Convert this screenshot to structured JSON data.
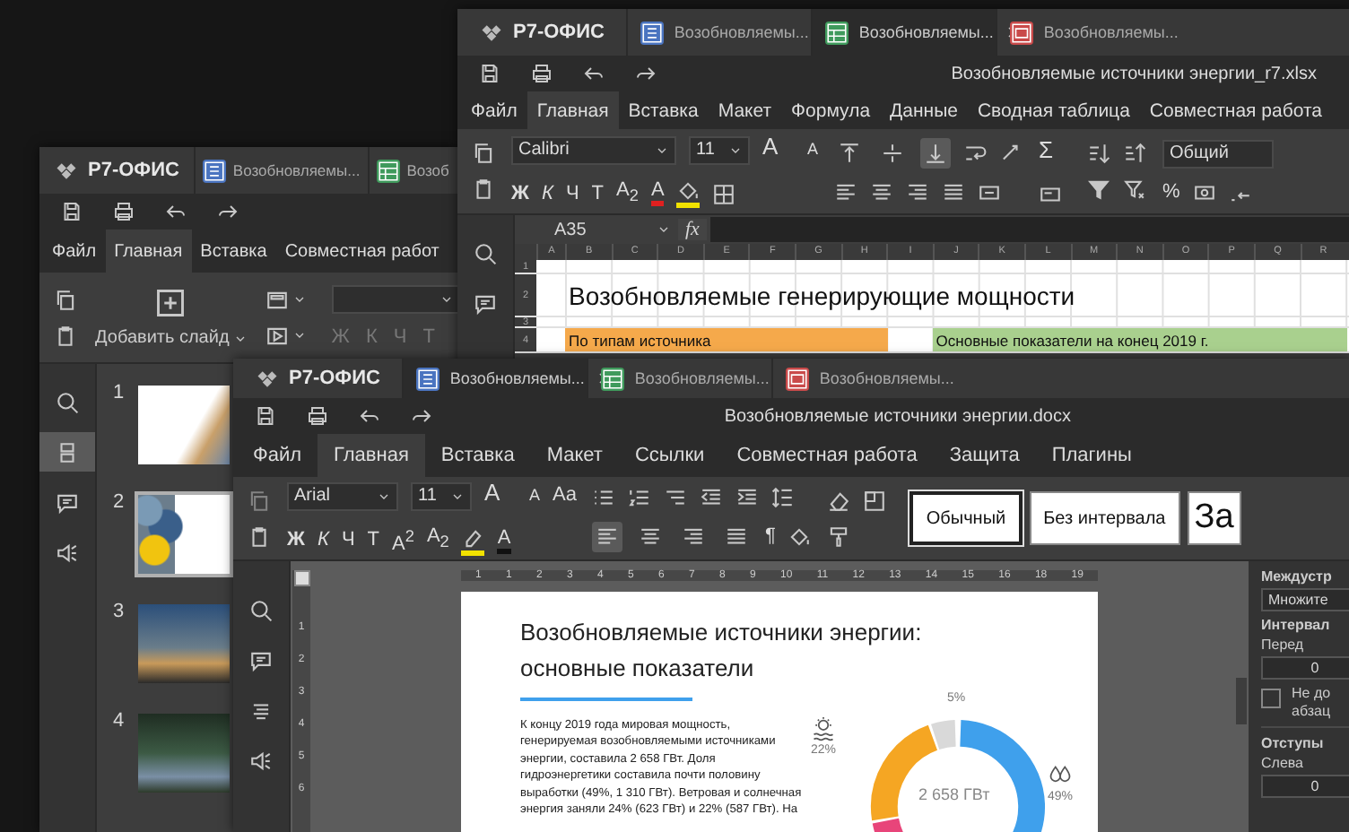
{
  "presentation_window": {
    "logo": "Р7-ОФИС",
    "tabs": [
      {
        "label": "Возобновляемы...",
        "kind": "document",
        "selected": false
      },
      {
        "label": "Возоб",
        "kind": "spreadsheet",
        "selected": false
      }
    ],
    "menu": [
      {
        "label": "Файл",
        "selected": false
      },
      {
        "label": "Главная",
        "selected": true
      },
      {
        "label": "Вставка",
        "selected": false
      },
      {
        "label": "Совместная работ",
        "selected": false
      }
    ],
    "add_slide": "Добавить слайд",
    "format_buttons": [
      {
        "label": "Ж",
        "disabled": true
      },
      {
        "label": "К",
        "disabled": true
      },
      {
        "label": "Ч",
        "disabled": true
      },
      {
        "label": "Т",
        "disabled": true
      }
    ],
    "sidebar": [
      {
        "selected": false
      },
      {
        "selected": true
      },
      {
        "selected": false
      },
      {
        "selected": false
      }
    ],
    "slides": [
      {
        "number": "1",
        "kind": "title",
        "selected": false
      },
      {
        "number": "2",
        "kind": "collage",
        "selected": true
      },
      {
        "number": "3",
        "kind": "photo",
        "selected": false
      },
      {
        "number": "4",
        "kind": "photo",
        "selected": false
      }
    ]
  },
  "spreadsheet_window": {
    "logo": "Р7-ОФИС",
    "tabs": [
      {
        "label": "Возобновляемы...",
        "kind": "document",
        "selected": false
      },
      {
        "label": "Возобновляемы...",
        "kind": "spreadsheet",
        "selected": true
      },
      {
        "label": "Возобновляемы...",
        "kind": "pdf",
        "selected": false
      }
    ],
    "filename": "Возобновляемые источники энергии_r7.xlsx",
    "menu": [
      {
        "label": "Файл",
        "selected": false
      },
      {
        "label": "Главная",
        "selected": true
      },
      {
        "label": "Вставка",
        "selected": false
      },
      {
        "label": "Макет",
        "selected": false
      },
      {
        "label": "Формула",
        "selected": false
      },
      {
        "label": "Данные",
        "selected": false
      },
      {
        "label": "Сводная таблица",
        "selected": false
      },
      {
        "label": "Совместная работа",
        "selected": false
      }
    ],
    "toolbar": {
      "font": "Calibri",
      "size": "11",
      "grow": "A",
      "shrink": "A",
      "bold": "Ж",
      "italic": "К",
      "underline": "Ч",
      "strike": "Т",
      "subscript": "A$_{2}$",
      "font_color": "A",
      "sum": "Σ",
      "number_format": "Общий",
      "percent": "%",
      "vertical_align": [
        {
          "selected": false
        },
        {
          "selected": false
        },
        {
          "selected": true
        }
      ]
    },
    "name_box": "A35",
    "fx": "fx",
    "columns": [
      "A",
      "B",
      "C",
      "D",
      "E",
      "F",
      "G",
      "H",
      "I",
      "J",
      "K",
      "L",
      "M",
      "N",
      "O",
      "P",
      "Q",
      "R"
    ],
    "rows": [
      {
        "number": "1",
        "cells": []
      },
      {
        "number": "2",
        "cells": [
          {},
          {
            "text": "Возобновляемые генерирующие мощности",
            "kind": "title"
          }
        ]
      },
      {
        "number": "3",
        "cells": []
      },
      {
        "number": "4",
        "cells": [
          {},
          {
            "text": "По типам источника",
            "kind": "header",
            "color": "#f5a94b"
          },
          {
            "color": "#f5a94b"
          },
          {
            "color": "#f5a94b"
          },
          {
            "color": "#f5a94b"
          },
          {
            "color": "#f5a94b"
          },
          {
            "color": "#f5a94b"
          },
          {
            "color": "#f5a94b"
          },
          {},
          {
            "text": "Основные показатели на конец 2019 г.",
            "kind": "header",
            "color": "#a9d08e"
          },
          {
            "color": "#a9d08e"
          },
          {
            "color": "#a9d08e"
          },
          {
            "color": "#a9d08e"
          },
          {
            "color": "#a9d08e"
          },
          {
            "color": "#a9d08e"
          },
          {
            "color": "#a9d08e"
          },
          {
            "color": "#a9d08e"
          },
          {
            "color": "#a9d08e"
          }
        ]
      }
    ]
  },
  "document_window": {
    "logo": "Р7-ОФИС",
    "tabs": [
      {
        "label": "Возобновляемы...",
        "kind": "document",
        "selected": true
      },
      {
        "label": "Возобновляемы...",
        "kind": "spreadsheet",
        "selected": false
      },
      {
        "label": "Возобновляемы...",
        "kind": "pdf",
        "selected": false
      }
    ],
    "filename": "Возобновляемые источники энергии.docx",
    "menu": [
      {
        "label": "Файл",
        "selected": false
      },
      {
        "label": "Главная",
        "selected": true
      },
      {
        "label": "Вставка",
        "selected": false
      },
      {
        "label": "Макет",
        "selected": false
      },
      {
        "label": "Ссылки",
        "selected": false
      },
      {
        "label": "Совместная работа",
        "selected": false
      },
      {
        "label": "Защита",
        "selected": false
      },
      {
        "label": "Плагины",
        "selected": false
      }
    ],
    "toolbar": {
      "font": "Arial",
      "size": "11",
      "grow": "A",
      "shrink": "A",
      "case": "Aa",
      "bold": "Ж",
      "italic": "К",
      "underline": "Ч",
      "strike": "Т",
      "superscript": "A$^{2}$",
      "subscript": "A$_{2}$",
      "font_color": "A",
      "pilcrow": "¶",
      "paragraph_align": [
        {
          "selected": true
        },
        {
          "selected": false
        },
        {
          "selected": false
        },
        {
          "selected": false
        }
      ]
    },
    "styles": [
      {
        "label": "Обычный",
        "selected": true
      },
      {
        "label": "Без интервала",
        "selected": false
      },
      {
        "label": "За",
        "selected": false,
        "kind": "heading"
      }
    ],
    "ruler": {
      "horizontal": [
        "1",
        "1",
        "2",
        "3",
        "4",
        "5",
        "6",
        "7",
        "8",
        "9",
        "10",
        "11",
        "12",
        "13",
        "14",
        "15",
        "16",
        "18",
        "19"
      ],
      "vertical": [
        "1",
        "2",
        "3",
        "4",
        "5",
        "6"
      ]
    },
    "page": {
      "heading": "Возобновляемые источники энергии: основные показатели",
      "paragraph": "К концу 2019 года мировая мощность, генерируемая возобновляемыми источниками энергии, составила 2 658 ГВт.  Доля гидроэнергетики составила почти половину выработки (49%, 1 310 ГВт). Ветровая и солнечная энергия заняли 24% (623 ГВт) и 22% (587 ГВт). На",
      "chart": {
        "total": "2 658 ГВт",
        "top_label": "5%",
        "left_label": "22%",
        "right_label": "49%"
      }
    },
    "panel": {
      "line_spacing": "Междустр",
      "line_spacing_value": "Множите",
      "spacing": "Интервал",
      "before": "Перед",
      "before_value": "0",
      "keep": {
        "lines": [
          "Не до",
          "абзац"
        ],
        "checked": false
      },
      "indents": "Отступы",
      "left": "Слева",
      "left_value": "0"
    }
  }
}
